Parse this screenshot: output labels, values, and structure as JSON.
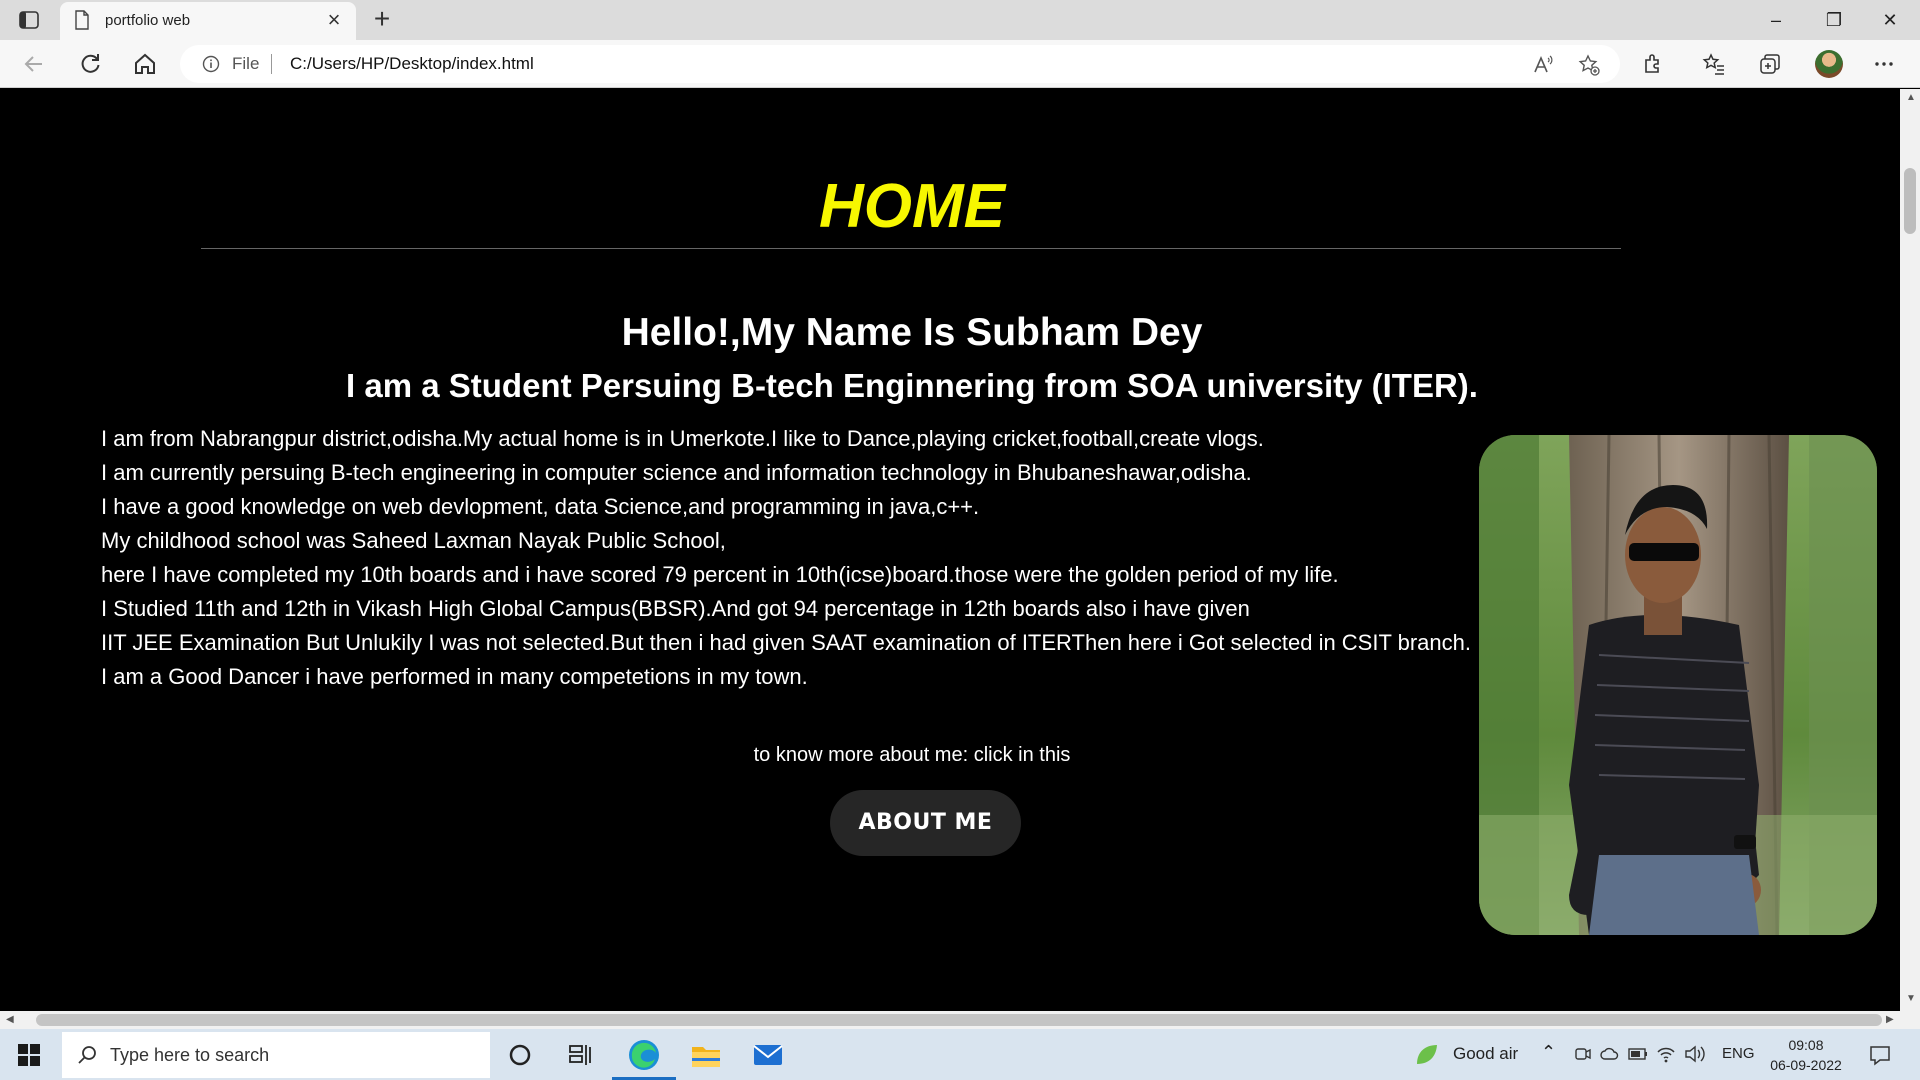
{
  "browser": {
    "tab_title": "portfolio web",
    "address_label": "File",
    "url": "C:/Users/HP/Desktop/index.html"
  },
  "page": {
    "heading": "HOME",
    "greeting": "Hello!,My Name Is Subham Dey",
    "subtitle": "I am a Student Persuing B-tech Enginnering from SOA university (ITER).",
    "bio_lines": [
      "I am from Nabrangpur district,odisha.My actual home is in Umerkote.I like to Dance,playing cricket,football,create vlogs.",
      "I am currently persuing B-tech engineering in computer science and information technology in Bhubaneshawar,odisha.",
      "I have a good knowledge on web devlopment, data Science,and programming in java,c++.",
      "My childhood school was Saheed Laxman Nayak Public School,",
      "here I have completed my 10th boards and i have scored 79 percent in 10th(icse)board.those were the golden period of my life.",
      "I Studied 11th and 12th in Vikash High Global Campus(BBSR).And got 94 percentage in 12th boards also i have given",
      "IIT JEE Examination But Unlukily I was not selected.But then i had given SAAT examination of ITERThen here i Got selected in CSIT branch.",
      "I am a Good Dancer i have performed in many competetions in my town."
    ],
    "cta_text": "to know more about me: click in this",
    "about_button": "ABOUT ME",
    "colors": {
      "heading": "#f7f700",
      "background": "#000000",
      "button": "#262626"
    }
  },
  "taskbar": {
    "search_placeholder": "Type here to search",
    "weather": "Good air",
    "language": "ENG",
    "time": "09:08",
    "date": "06-09-2022"
  }
}
